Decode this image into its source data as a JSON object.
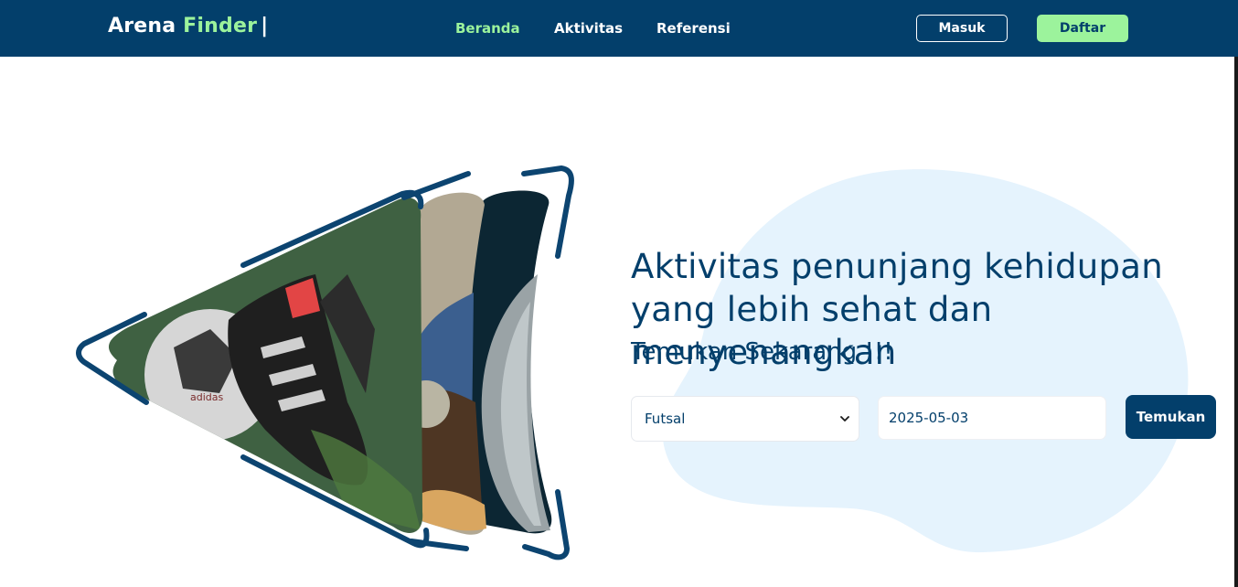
{
  "nav": {
    "brand_main": "Arena",
    "brand_accent": "Finder",
    "brand_cursor": "|",
    "links": [
      {
        "label": "Beranda",
        "active": true
      },
      {
        "label": "Aktivitas",
        "active": false
      },
      {
        "label": "Referensi",
        "active": false
      }
    ],
    "login_label": "Masuk",
    "register_label": "Daftar"
  },
  "hero": {
    "headline": "Aktivitas penunjang kehidupan yang lebih sehat dan menyenangkan",
    "subheadline": "Temukan Sekarang !!!",
    "image_icon": "football-boot-and-ball-illustration"
  },
  "search": {
    "sport_selected": "Futsal",
    "date_value": "2025-05-03",
    "submit_label": "Temukan"
  },
  "colors": {
    "navy": "#033f6b",
    "accent_green": "#9cf39c",
    "blob": "#e5f3fd",
    "field_green": "#3f6142"
  }
}
